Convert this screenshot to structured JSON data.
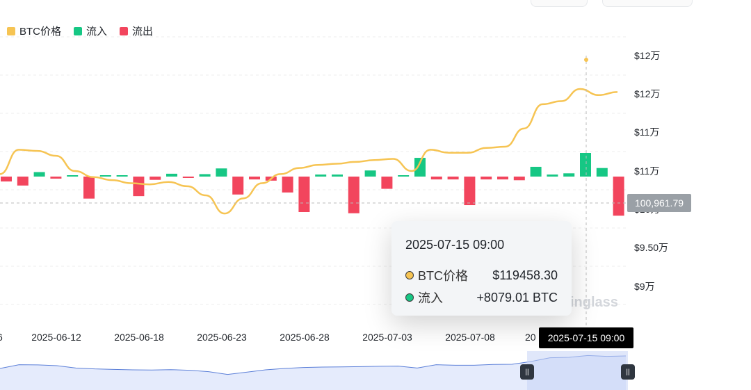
{
  "legend": {
    "price_label": "BTC价格",
    "inflow_label": "流入",
    "outflow_label": "流出"
  },
  "colors": {
    "price": "#f6c453",
    "inflow": "#16c784",
    "outflow": "#f2455d",
    "navigator_fill": "#dfe6fb",
    "navigator_line": "#5b7fd8"
  },
  "chart_data": {
    "type": "bar",
    "yaxis": {
      "ticks": [
        "$12万",
        "$12万",
        "$11万",
        "$11万",
        "$10万",
        "$9.50万",
        "$9万"
      ],
      "range": [
        87000,
        125000
      ]
    },
    "xaxis": {
      "ticks": [
        "2025-06-12",
        "2025-06-18",
        "2025-06-23",
        "2025-06-28",
        "2025-07-03",
        "2025-07-08",
        "2025-07-15 09:00"
      ],
      "first_partial": "6",
      "tick_partial": "20"
    },
    "series": [
      {
        "name": "BTC价格",
        "kind": "line",
        "values": [
          105500,
          109500,
          109300,
          108500,
          106000,
          105000,
          104500,
          104000,
          103800,
          104200,
          103500,
          102000,
          99000,
          101500,
          104000,
          105500,
          106500,
          107000,
          107200,
          107500,
          107800,
          108000,
          106000,
          109500,
          109000,
          109000,
          109800,
          110000,
          113000,
          117000,
          117500,
          119500,
          118500,
          119000
        ]
      },
      {
        "name": "流入/流出",
        "kind": "bar",
        "values": [
          -1200,
          -2200,
          1100,
          -500,
          300,
          -5400,
          200,
          100,
          -4800,
          -800,
          700,
          -200,
          600,
          2000,
          -4400,
          -700,
          -1000,
          -3900,
          -8700,
          500,
          500,
          -9000,
          1500,
          -3000,
          300,
          4600,
          -700,
          -700,
          -7000,
          -700,
          -700,
          -900,
          2400,
          500,
          800,
          5800,
          2100,
          -9600
        ]
      }
    ],
    "crosshair": {
      "x_label": "2025-07-15 09:00",
      "y_label": "100,961.79"
    }
  },
  "tooltip": {
    "date": "2025-07-15 09:00",
    "price_label": "BTC价格",
    "price_value": "$119458.30",
    "flow_label": "流入",
    "flow_value": "+8079.01 BTC"
  },
  "watermark": "inglass"
}
